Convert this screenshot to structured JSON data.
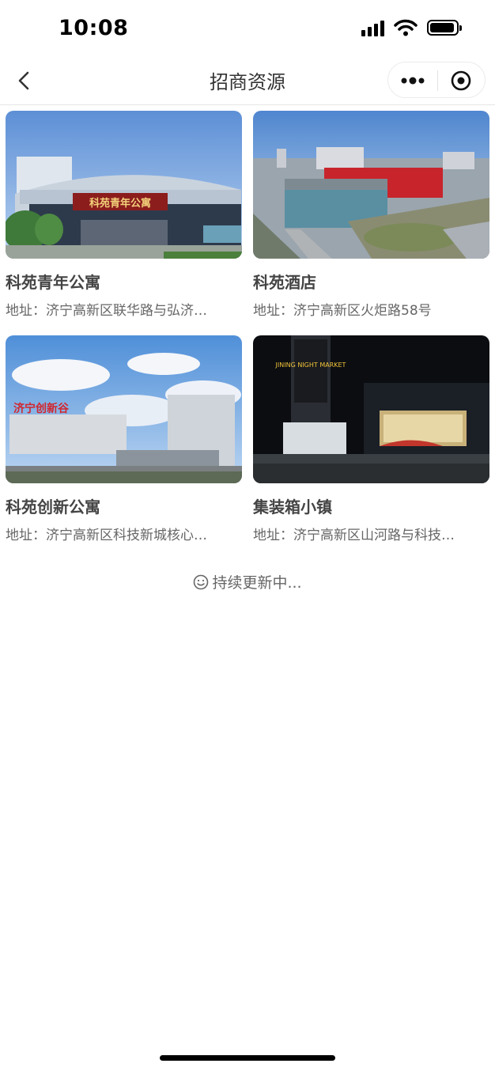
{
  "status_bar": {
    "time": "10:08"
  },
  "nav": {
    "title": "招商资源"
  },
  "cards": [
    {
      "title": "科苑青年公寓",
      "address": "地址：济宁高新区联华路与弘济…",
      "sign_text": "科苑青年公寓"
    },
    {
      "title": "科苑酒店",
      "address": "地址：济宁高新区火炬路58号"
    },
    {
      "title": "科苑创新公寓",
      "address": "地址：济宁高新区科技新城核心…",
      "sign_text": "济宁创新谷"
    },
    {
      "title": "集装箱小镇",
      "address": "地址：济宁高新区山河路与科技…",
      "sign_text": "JINING NIGHT MARKET"
    }
  ],
  "footer": {
    "updating": "持续更新中..."
  },
  "colors": {
    "text": "#333333",
    "muted": "#666666",
    "divider": "#e6e6e6"
  }
}
